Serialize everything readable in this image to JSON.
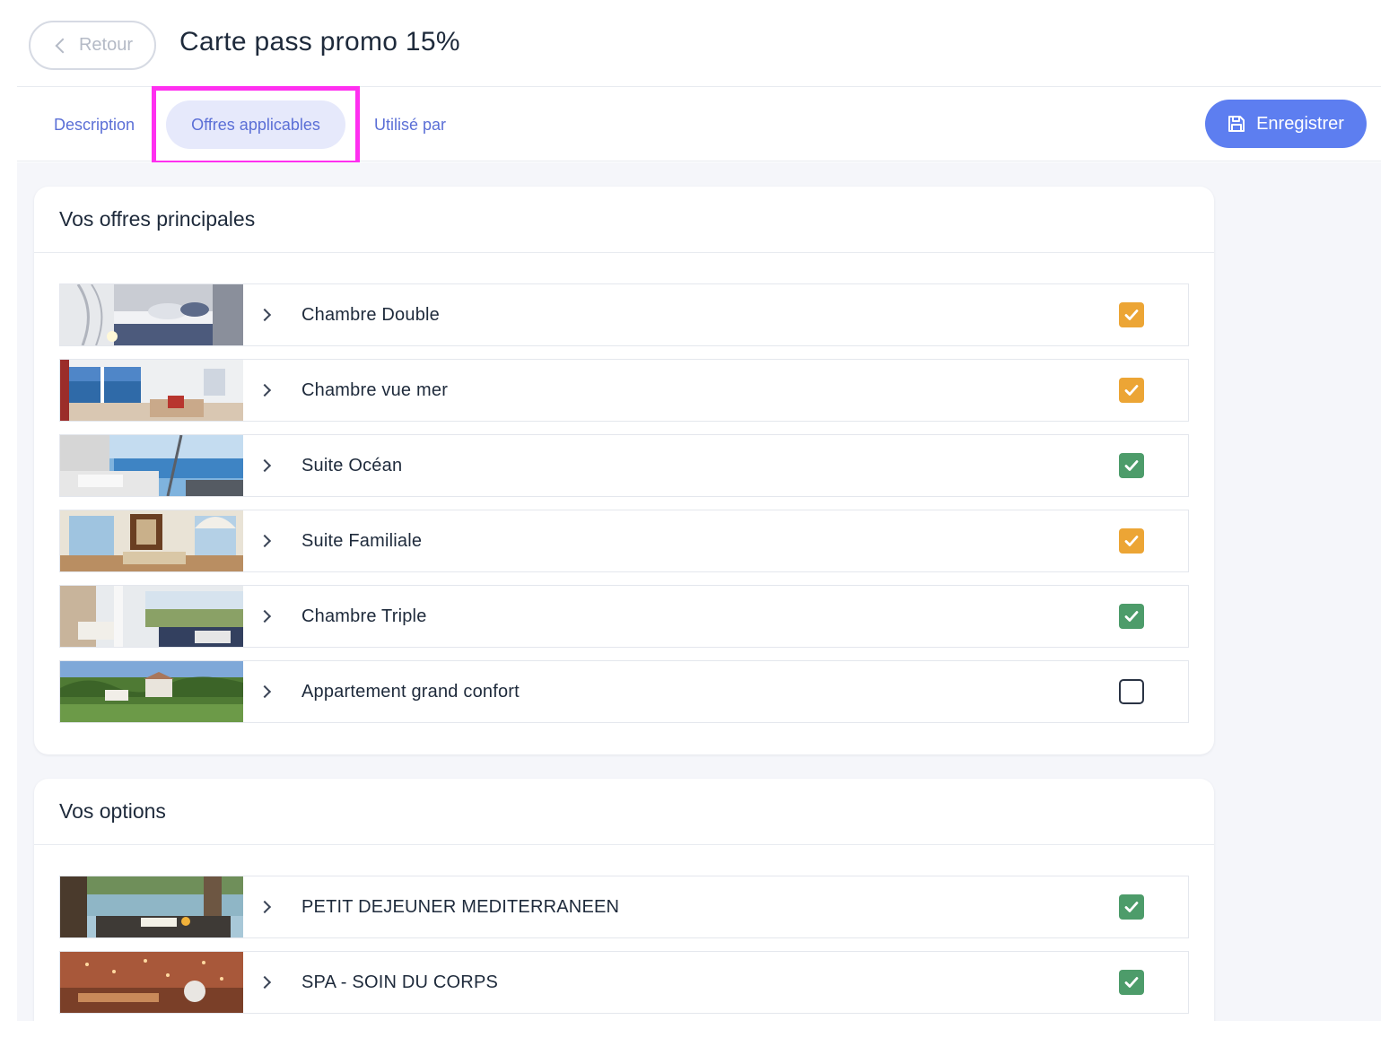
{
  "header": {
    "back_label": "Retour",
    "title": "Carte pass promo 15%"
  },
  "tabs": [
    {
      "label": "Description",
      "active": false
    },
    {
      "label": "Offres applicables",
      "active": true
    },
    {
      "label": "Utilisé par",
      "active": false
    }
  ],
  "toolbar": {
    "save_label": "Enregistrer",
    "save_icon": "floppy-disk-icon",
    "accent_color": "#5d7ef0",
    "highlight_color": "#ff2ff0"
  },
  "principales": {
    "title": "Vos offres principales",
    "items": [
      {
        "label": "Chambre Double",
        "checked": true,
        "check_color": "#eca535"
      },
      {
        "label": "Chambre vue mer",
        "checked": true,
        "check_color": "#eca535"
      },
      {
        "label": "Suite Océan",
        "checked": true,
        "check_color": "#4d9c6a"
      },
      {
        "label": "Suite Familiale",
        "checked": true,
        "check_color": "#eca535"
      },
      {
        "label": "Chambre Triple",
        "checked": true,
        "check_color": "#4d9c6a"
      },
      {
        "label": "Appartement grand confort",
        "checked": false,
        "check_color": null
      }
    ]
  },
  "options": {
    "title": "Vos options",
    "items": [
      {
        "label": "PETIT DEJEUNER MEDITERRANEEN",
        "checked": true,
        "check_color": "#4d9c6a"
      },
      {
        "label": "SPA - SOIN DU CORPS",
        "checked": true,
        "check_color": "#4d9c6a"
      }
    ]
  }
}
